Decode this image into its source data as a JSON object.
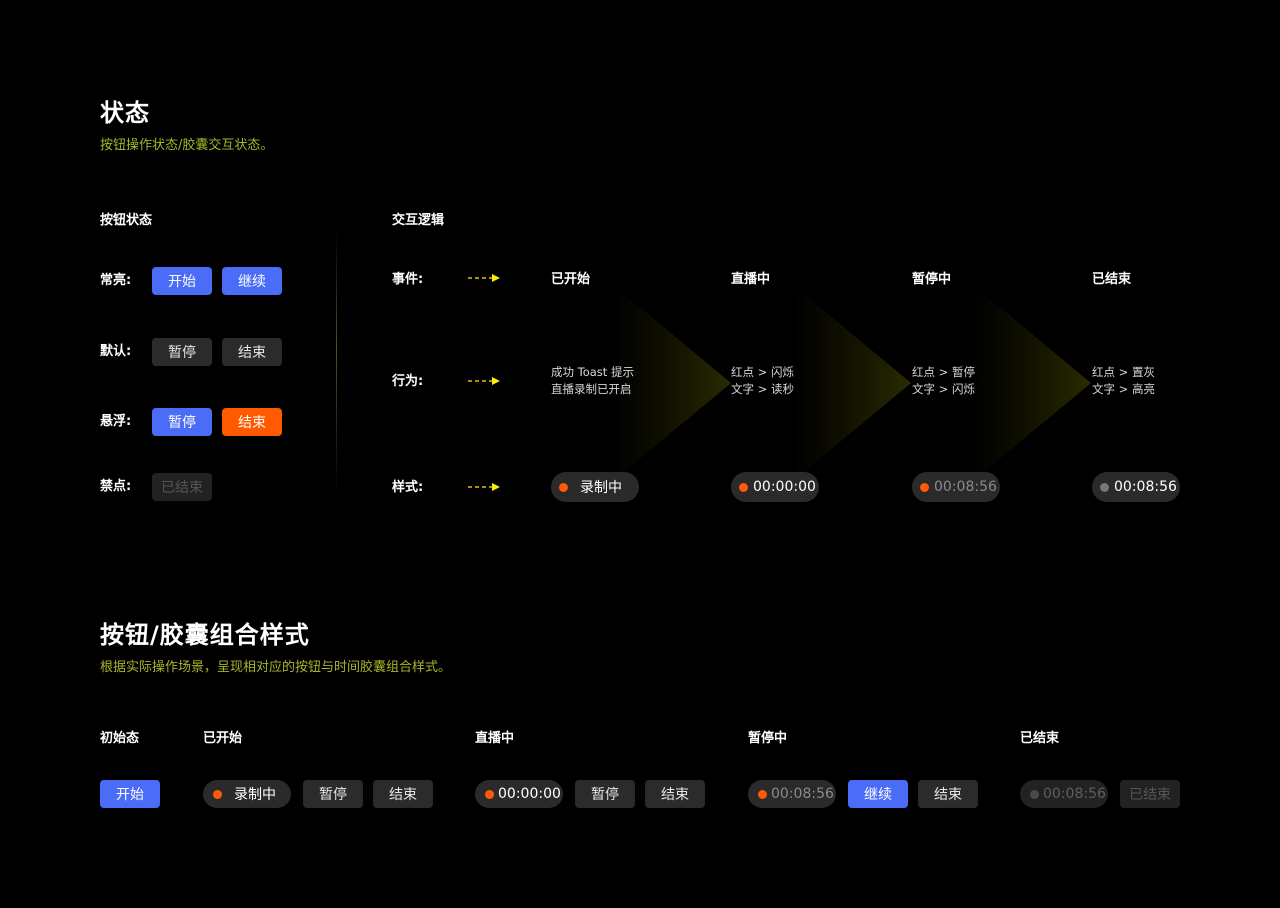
{
  "section1": {
    "title": "状态",
    "subtitle": "按钮操作状态/胶囊交互状态。",
    "button_states": {
      "heading": "按钮状态",
      "rows": [
        {
          "label": "常亮:",
          "buttons": [
            {
              "text": "开始",
              "style": "primary"
            },
            {
              "text": "继续",
              "style": "primary"
            }
          ]
        },
        {
          "label": "默认:",
          "buttons": [
            {
              "text": "暂停",
              "style": "default"
            },
            {
              "text": "结束",
              "style": "default"
            }
          ]
        },
        {
          "label": "悬浮:",
          "buttons": [
            {
              "text": "暂停",
              "style": "primary-hover"
            },
            {
              "text": "结束",
              "style": "danger-hover"
            }
          ]
        },
        {
          "label": "禁点:",
          "buttons": [
            {
              "text": "已结束",
              "style": "disabled"
            }
          ]
        }
      ]
    },
    "interaction_logic": {
      "heading": "交互逻辑",
      "row_labels": {
        "event": "事件:",
        "behavior": "行为:",
        "style": "样式:"
      },
      "arrow_icon": "dashed-arrow-right",
      "columns": [
        {
          "event": "已开始",
          "behavior": [
            "成功 Toast 提示",
            "直播录制已开启"
          ],
          "pill": {
            "text": "录制中",
            "dot": "orange",
            "text_tone": "normal"
          }
        },
        {
          "event": "直播中",
          "behavior": [
            "红点 > 闪烁",
            "文字 > 读秒"
          ],
          "pill": {
            "text": "00:00:00",
            "dot": "orange",
            "text_tone": "normal"
          }
        },
        {
          "event": "暂停中",
          "behavior": [
            "红点 > 暂停",
            "文字 > 闪烁"
          ],
          "pill": {
            "text": "00:08:56",
            "dot": "orange",
            "text_tone": "dim"
          }
        },
        {
          "event": "已结束",
          "behavior": [
            "红点 > 置灰",
            "文字 > 高亮"
          ],
          "pill": {
            "text": "00:08:56",
            "dot": "gray",
            "text_tone": "normal"
          }
        }
      ]
    }
  },
  "section2": {
    "title": "按钮/胶囊组合样式",
    "subtitle": "根据实际操作场景，呈现相对应的按钮与时间胶囊组合样式。",
    "groups": [
      {
        "heading": "初始态",
        "items": [
          {
            "type": "button",
            "text": "开始",
            "style": "primary"
          }
        ]
      },
      {
        "heading": "已开始",
        "items": [
          {
            "type": "pill",
            "text": "录制中"
          },
          {
            "type": "button",
            "text": "暂停",
            "style": "default"
          },
          {
            "type": "button",
            "text": "结束",
            "style": "default"
          }
        ]
      },
      {
        "heading": "直播中",
        "items": [
          {
            "type": "pill",
            "text": "00:00:00"
          },
          {
            "type": "button",
            "text": "暂停",
            "style": "default"
          },
          {
            "type": "button",
            "text": "结束",
            "style": "default"
          }
        ]
      },
      {
        "heading": "暂停中",
        "items": [
          {
            "type": "pill",
            "text": "00:08:56"
          },
          {
            "type": "button",
            "text": "继续",
            "style": "primary"
          },
          {
            "type": "button",
            "text": "结束",
            "style": "default"
          }
        ]
      },
      {
        "heading": "已结束",
        "items": [
          {
            "type": "pill",
            "text": "00:08:56",
            "state": "disabled"
          },
          {
            "type": "button",
            "text": "已结束",
            "style": "disabled"
          }
        ]
      }
    ]
  },
  "colors": {
    "primary": "#4a6cf7",
    "danger": "#ff5a00",
    "record_dot": "#ff5a0a",
    "accent_subtitle": "#a8b52a",
    "arrow": "#ffee00",
    "button_default": "#2b2b2b",
    "pill_bg": "#2a2a2a"
  }
}
